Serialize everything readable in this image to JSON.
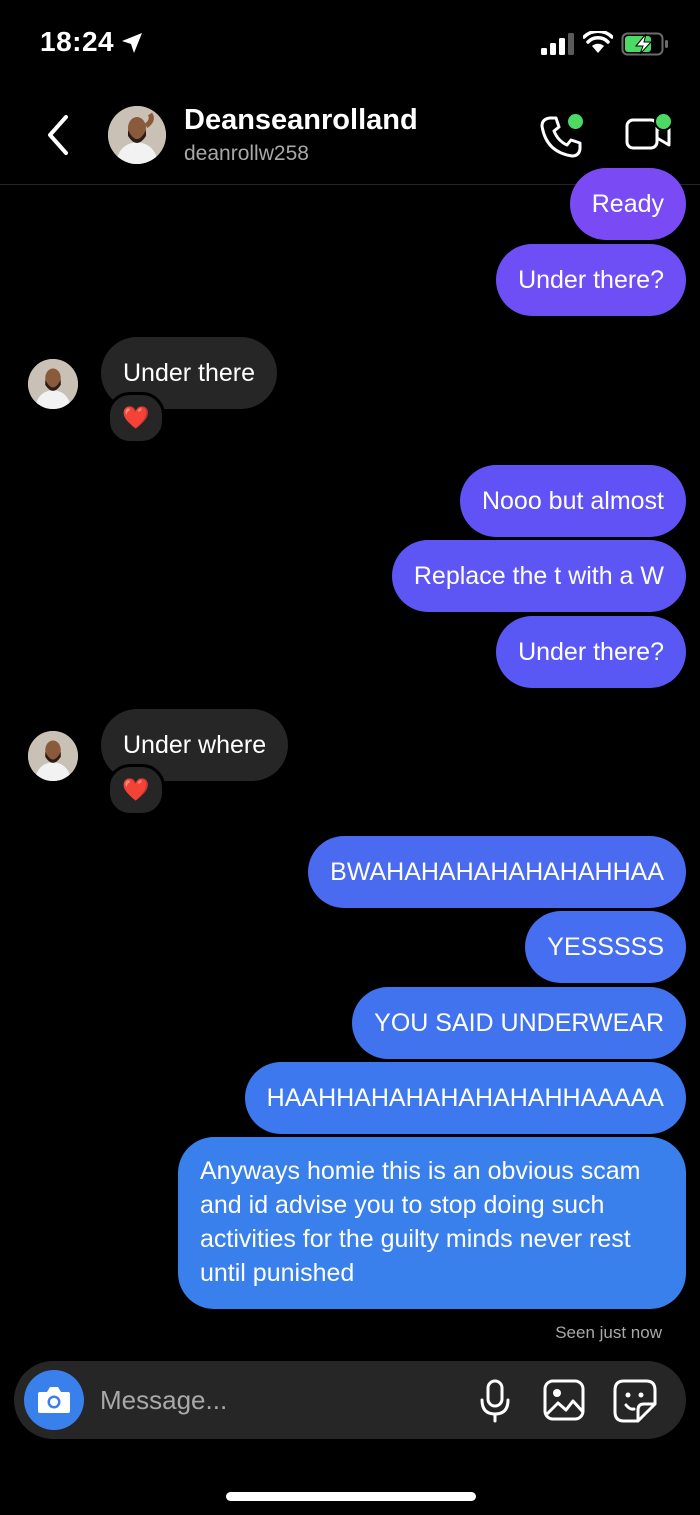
{
  "status_bar": {
    "time": "18:24"
  },
  "header": {
    "contact_name": "Deanseanrolland",
    "contact_handle": "deanrollw258"
  },
  "messages": [
    {
      "direction": "out",
      "text": "Ready",
      "color": "#7a4af4"
    },
    {
      "direction": "out",
      "text": "Under there?",
      "color": "#6e4ff5"
    },
    {
      "direction": "in",
      "text": "Under there",
      "reaction": "❤️"
    },
    {
      "direction": "out",
      "text": "Nooo but almost",
      "color": "#6152f5"
    },
    {
      "direction": "out",
      "text": "Replace the t with a W",
      "color": "#5d55f4"
    },
    {
      "direction": "out",
      "text": "Under there?",
      "color": "#5a58f4"
    },
    {
      "direction": "in",
      "text": "Under where",
      "reaction": "❤️"
    },
    {
      "direction": "out",
      "text": "BWAHAHAHAHAHAHAHHAA",
      "color": "#4a6af0"
    },
    {
      "direction": "out",
      "text": "YESSSSS",
      "color": "#466ef0"
    },
    {
      "direction": "out",
      "text": "YOU SAID UNDERWEAR",
      "color": "#4273ef"
    },
    {
      "direction": "out",
      "text": "HAAHHAHAHAHAHAHAHHAAAAA",
      "color": "#3e78ee"
    },
    {
      "direction": "out",
      "text": "Anyways homie this is an obvious scam and id advise you to stop doing such activities for the guilty minds never rest until punished",
      "color": "#3a80ec"
    }
  ],
  "seen_status": "Seen just now",
  "composer": {
    "placeholder": "Message..."
  },
  "colors": {
    "accent": "#3a80ec",
    "online": "#4cd964",
    "incoming_bubble": "#262626"
  }
}
